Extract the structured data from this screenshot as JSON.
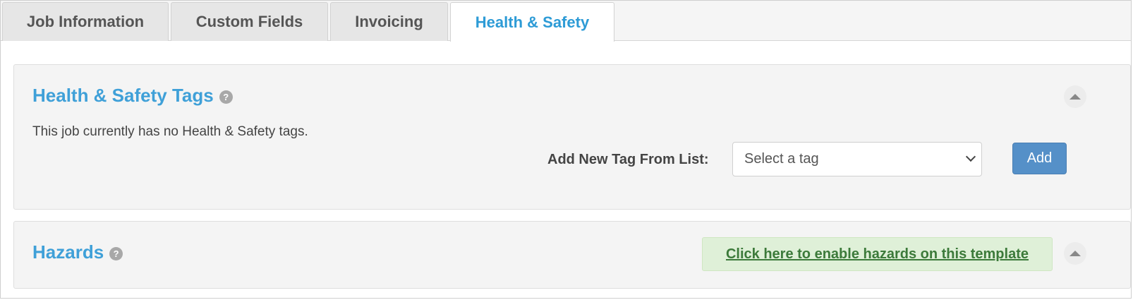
{
  "tabs": [
    {
      "label": "Job Information",
      "active": false
    },
    {
      "label": "Custom Fields",
      "active": false
    },
    {
      "label": "Invoicing",
      "active": false
    },
    {
      "label": "Health & Safety",
      "active": true
    }
  ],
  "tags_panel": {
    "title": "Health & Safety Tags",
    "help_icon_glyph": "?",
    "empty_message": "This job currently has no Health & Safety tags.",
    "add_label": "Add New Tag From List:",
    "select_value": "Select a tag",
    "add_button_label": "Add"
  },
  "hazards_panel": {
    "title": "Hazards",
    "help_icon_glyph": "?",
    "enable_link": "Click here to enable hazards on this template"
  },
  "colors": {
    "accent": "#3fa0d8",
    "button": "#5590c8",
    "success_bg": "#dff0d8",
    "success_text": "#3c7a3a"
  }
}
